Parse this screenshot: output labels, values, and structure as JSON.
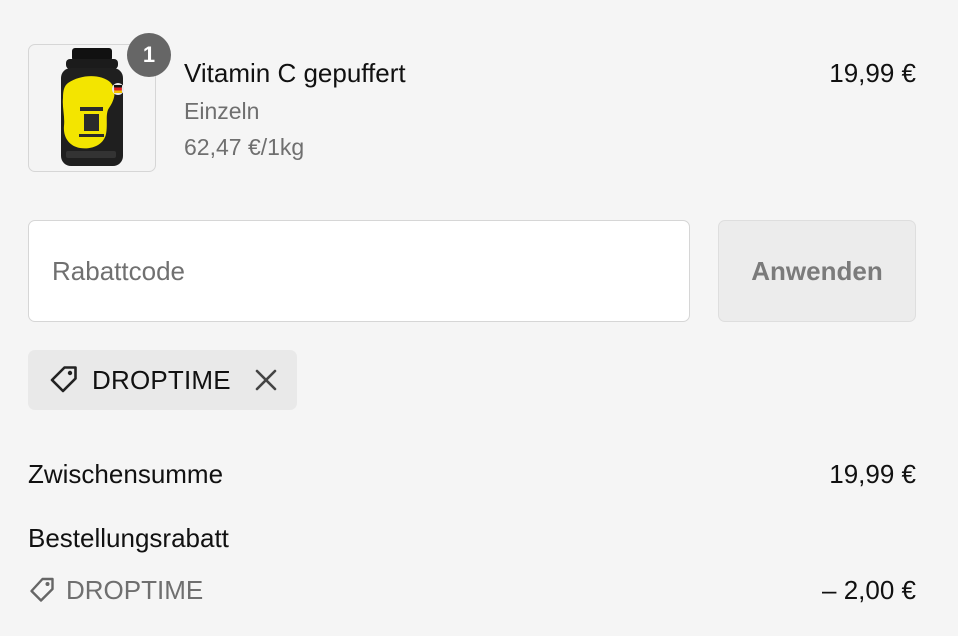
{
  "line_item": {
    "quantity": "1",
    "name": "Vitamin C gepuffert",
    "variant": "Einzeln",
    "unit_price": "62,47 €/1kg",
    "price": "19,99 €"
  },
  "discount": {
    "placeholder": "Rabattcode",
    "apply_label": "Anwenden",
    "applied_code": "DROPTIME"
  },
  "summary": {
    "subtotal_label": "Zwischensumme",
    "subtotal_value": "19,99 €",
    "order_discount_label": "Bestellungsrabatt",
    "order_discount_code": "DROPTIME",
    "order_discount_value": "– 2,00 €"
  },
  "icons": {
    "tag": "tag-icon",
    "close": "close-icon"
  },
  "colors": {
    "page_background": "#f5f5f5",
    "badge": "#666666",
    "muted_text": "#6f6f6f",
    "chip_background": "#e9e9e9",
    "product_label": "#f0e000",
    "bottle": "#1f1f1f"
  }
}
